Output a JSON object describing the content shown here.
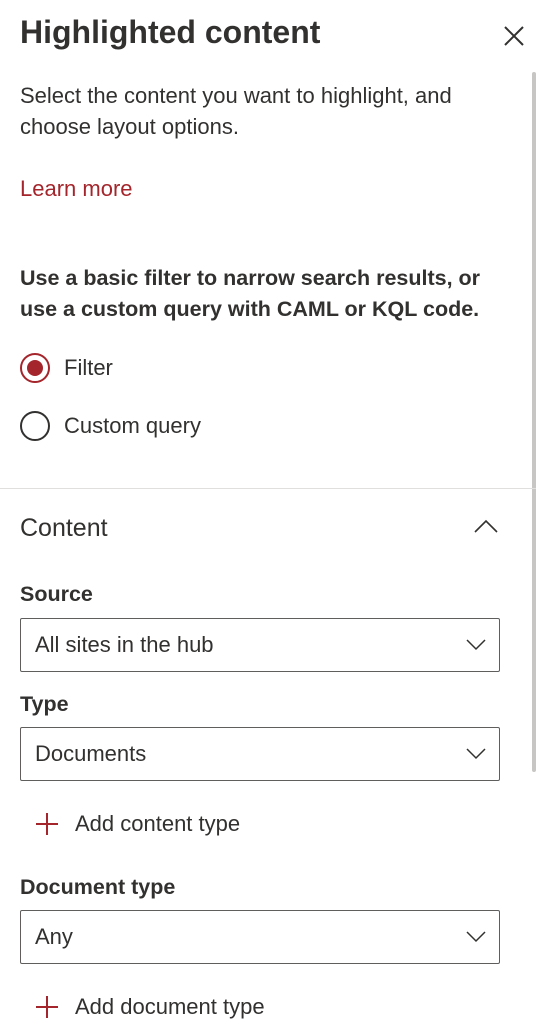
{
  "panel": {
    "title": "Highlighted content",
    "description": "Select the content you want to highlight, and choose layout options.",
    "learn_more": "Learn more",
    "instructions": "Use a basic filter to narrow search results, or use a custom query with CAML or KQL code.",
    "query_mode": {
      "options": [
        {
          "label": "Filter",
          "checked": true
        },
        {
          "label": "Custom query",
          "checked": false
        }
      ]
    }
  },
  "content_section": {
    "heading": "Content",
    "expanded": true,
    "source": {
      "label": "Source",
      "value": "All sites in the hub"
    },
    "type": {
      "label": "Type",
      "value": "Documents"
    },
    "add_content_type": "Add content type",
    "document_type": {
      "label": "Document type",
      "value": "Any"
    },
    "add_document_type": "Add document type"
  },
  "colors": {
    "accent": "#a4262c",
    "text": "#323130",
    "border": "#605e5c",
    "divider": "#e1dfdd"
  },
  "icons": {
    "close": "close-icon",
    "collapse": "chevron-up-icon",
    "dropdown": "chevron-down-icon",
    "add": "plus-icon"
  }
}
